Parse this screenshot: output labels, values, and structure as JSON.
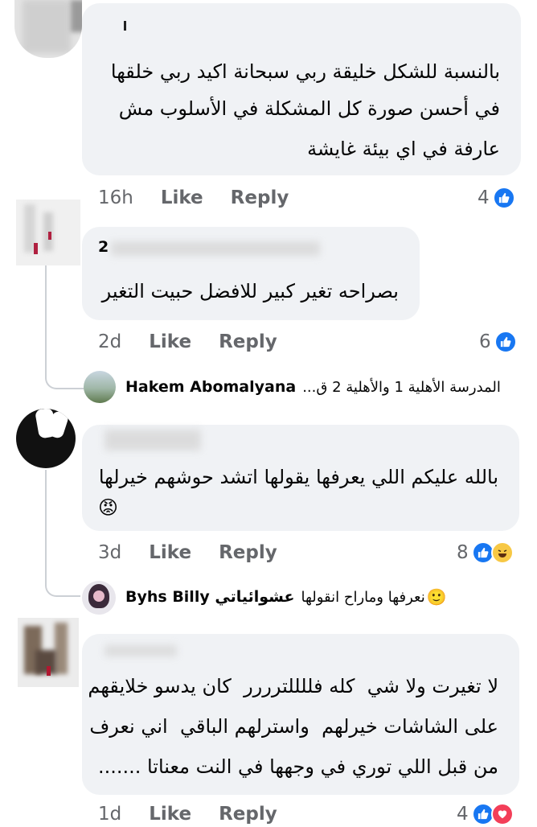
{
  "comments": [
    {
      "text_lines": [
        "بالنسبة للشكل خليقة ربي سبحانة اكيد ربي خلقها",
        "في أحسن صورة كل المشكلة في الأسلوب مش",
        "عارفة في اي بيئة غايشة"
      ],
      "time": "16h",
      "like": "Like",
      "reply": "Reply",
      "reaction_count": "4"
    },
    {
      "author": "2",
      "text_lines": [
        "بصراحه تغير كبير للافضل حبيت التغير"
      ],
      "time": "2d",
      "like": "Like",
      "reply": "Reply",
      "reaction_count": "6"
    },
    {
      "text_lines": [
        "بالله عليكم اللي يعرفها يقولها اتشد حوشهم خيرلها"
      ],
      "emoji": "😡",
      "time": "3d",
      "like": "Like",
      "reply": "Reply",
      "reaction_count": "8"
    },
    {
      "text_lines": [
        "لا تغيرت ولا شي  كله فللللترررر  كان يدسو خلايقهم",
        "على الشاشات خيرلهم  واسترلهم الباقي  اني نعرف",
        "من قبل اللي توري في وجهها في النت معناتا ......."
      ],
      "time": "1d",
      "like": "Like",
      "reply": "Reply",
      "reaction_count": "4"
    }
  ],
  "replies": [
    {
      "author": "Hakem Abomalyana",
      "snippet": "المدرسة الأهلية 1 والأهلية 2 ق..."
    },
    {
      "author": "Byhs Billy عشوائياتي",
      "snippet": "نعرفها وماراح انقولها",
      "emoji": "🙂"
    }
  ],
  "icons": {
    "like": "like-icon",
    "haha": "haha-icon",
    "love": "love-icon"
  },
  "colors": {
    "like_blue": "#1877f2",
    "bubble_bg": "#f0f2f5",
    "meta_gray": "#65676b"
  }
}
